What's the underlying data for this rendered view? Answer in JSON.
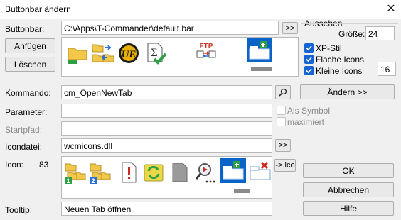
{
  "window": {
    "title": "Buttonbar ändern",
    "close": "✕"
  },
  "buttonbar": {
    "label": "Buttonbar:",
    "path": "C:\\Apps\\T-Commander\\default.bar",
    "browse": ">>",
    "add": "Anfügen",
    "delete": "Löschen",
    "icons": [
      "new-folder-icon",
      "sync-dirs-icon",
      "ultraedit-icon",
      "checksum-icon",
      "ftp-icon",
      "new-tab-icon"
    ]
  },
  "appearance": {
    "group_label": "Aussehen",
    "size_label": "Größe:",
    "size_value": "24",
    "xp_style": {
      "label": "XP-Stil",
      "checked": true
    },
    "flat_icons": {
      "label": "Flache Icons",
      "checked": true
    },
    "small_icons": {
      "label": "Kleine Icons",
      "checked": true,
      "value": "16"
    }
  },
  "command": {
    "label": "Kommando:",
    "value": "cm_OpenNewTab",
    "change": "Ändern >>"
  },
  "parameter": {
    "label": "Parameter:",
    "value": "",
    "as_symbol": "Als Symbol",
    "maximized": "maximiert"
  },
  "startpath": {
    "label": "Startpfad:",
    "value": ""
  },
  "iconfile": {
    "label": "Icondatei:",
    "value": "wcmicons.dll",
    "browse": ">>"
  },
  "icon": {
    "label": "Icon:",
    "index": "83",
    "to_ico": "->.ico",
    "choices": [
      "folder-panel-1-icon",
      "folder-panel-2-icon",
      "info-icon",
      "refresh-icon",
      "blank-page-icon",
      "search-preview-icon",
      "new-tab-icon",
      "close-tab-icon"
    ]
  },
  "tooltip": {
    "label": "Tooltip:",
    "value": "Neuen Tab öffnen"
  },
  "actions": {
    "ok": "OK",
    "cancel": "Abbrechen",
    "help": "Hilfe"
  },
  "colors": {
    "selection": "#0a64c8",
    "check": "#1664d4",
    "accent_green": "#2ea043"
  }
}
